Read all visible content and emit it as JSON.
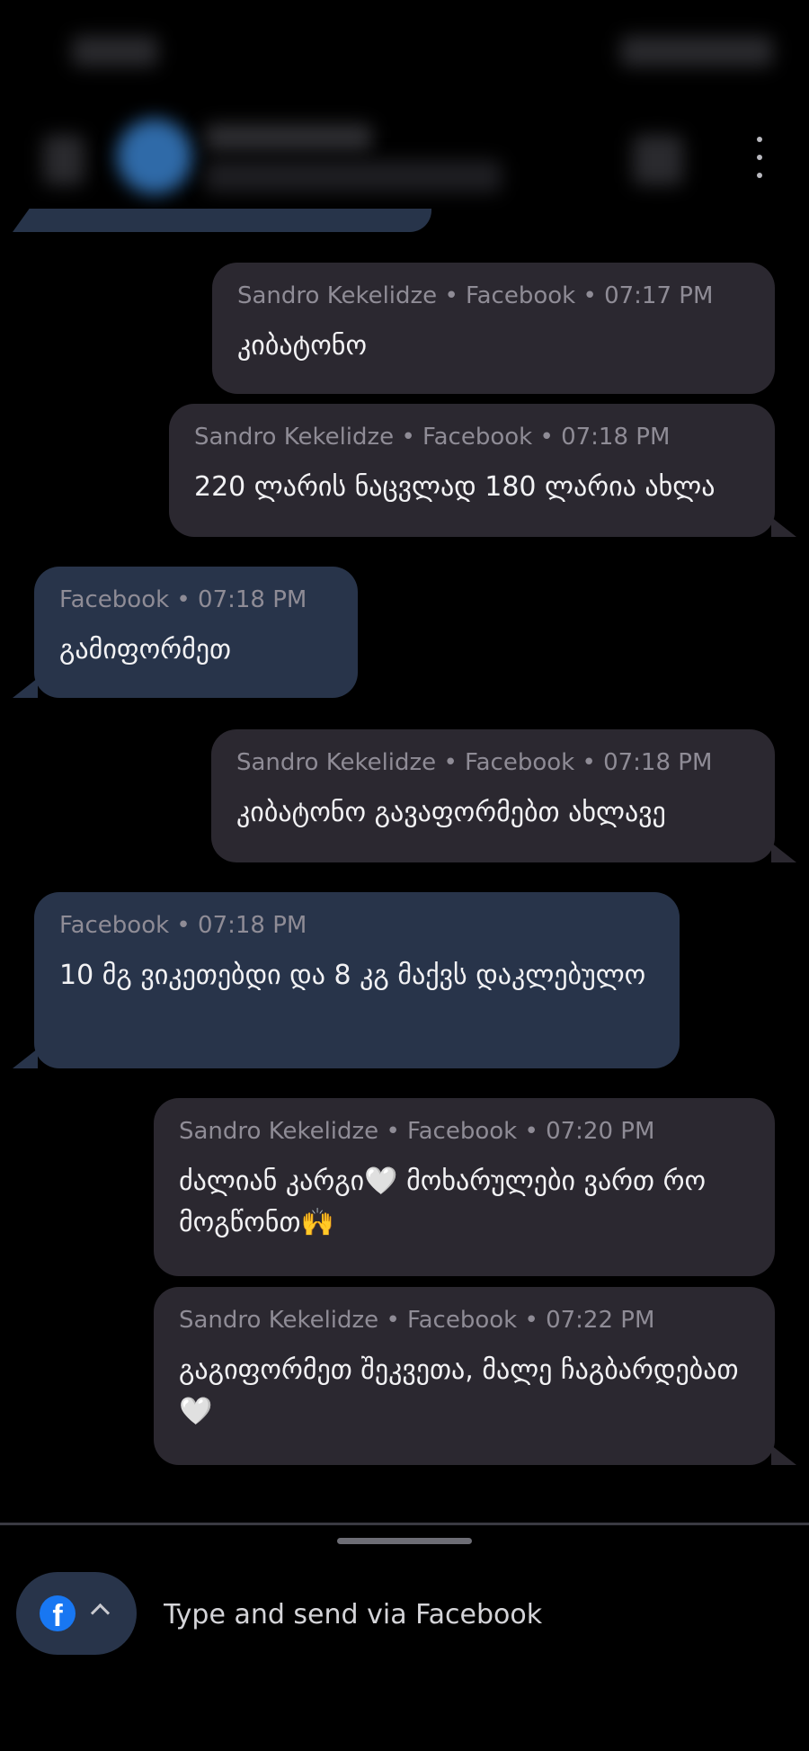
{
  "header": {
    "menu_icon": "more-vertical-icon"
  },
  "messages": [
    {
      "direction": "outgoing",
      "meta": "Sandro Kekelidze • Facebook • 07:17 PM",
      "text": "კიბატონო"
    },
    {
      "direction": "outgoing",
      "meta": "Sandro Kekelidze • Facebook • 07:18 PM",
      "text": "220 ლარის ნაცვლად 180 ლარია ახლა"
    },
    {
      "direction": "incoming",
      "meta": "Facebook • 07:18 PM",
      "text": "გამიფორმეთ"
    },
    {
      "direction": "outgoing",
      "meta": "Sandro Kekelidze • Facebook • 07:18 PM",
      "text": "კიბატონო გავაფორმებთ ახლავე"
    },
    {
      "direction": "incoming",
      "meta": "Facebook • 07:18 PM",
      "text": "10 მგ ვიკეთებდი და 8 კგ მაქვს დაკლებულო"
    },
    {
      "direction": "outgoing",
      "meta": "Sandro Kekelidze • Facebook • 07:20 PM",
      "text": "ძალიან კარგი🤍 მოხარულები ვართ რო მოგწონთ🙌"
    },
    {
      "direction": "outgoing",
      "meta": "Sandro Kekelidze • Facebook • 07:22 PM",
      "text": "გაგიფორმეთ შეკვეთა, მალე ჩაგბარდებათ🤍"
    }
  ],
  "composer": {
    "channel_icon": "facebook-icon",
    "channel_glyph": "f",
    "expand_icon": "chevron-up-icon",
    "placeholder": "Type and send via Facebook"
  },
  "colors": {
    "background": "#000000",
    "outgoing_bubble": "#2b2830",
    "incoming_bubble": "#28344a",
    "meta_text": "#8f8c96",
    "facebook_blue": "#1877f2"
  }
}
